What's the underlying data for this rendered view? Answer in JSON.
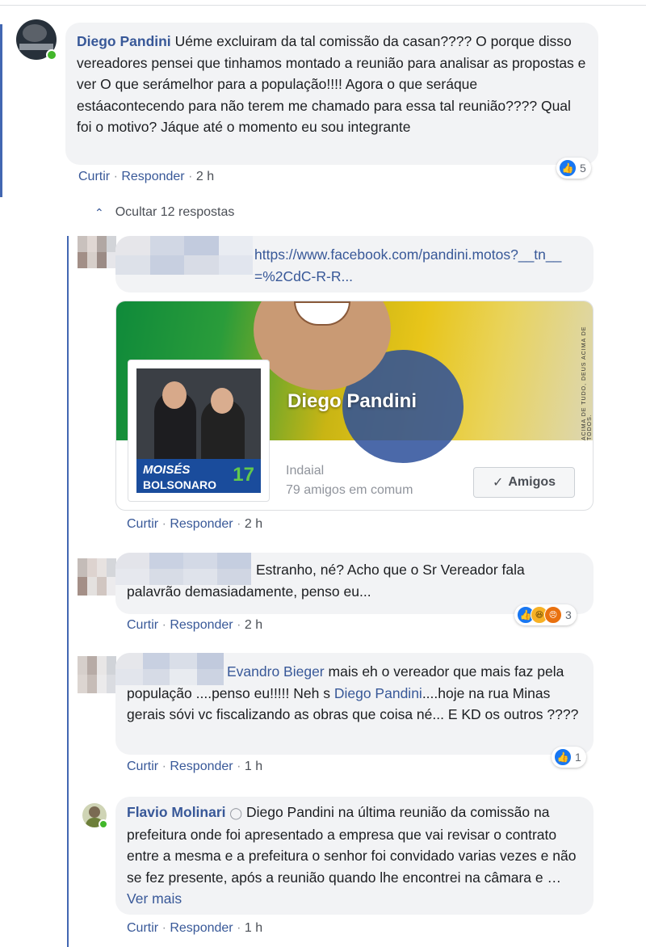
{
  "main_comment": {
    "author": "Diego Pandini",
    "text": "Uéme excluiram da tal comissão da casan???? O porque disso vereadores pensei que tinhamos montado a reunião para analisar as propostas e ver O que serámelhor para a população!!!! Agora o que seráque estáacontecendo para não terem me chamado para essa tal reunião???? Qual foi o motivo? Jáque até o momento eu sou integrante",
    "actions": {
      "like": "Curtir",
      "reply": "Responder",
      "time": "2 h"
    },
    "reaction_count": "5"
  },
  "replies_toggle": {
    "label": "Ocultar 12 respostas"
  },
  "reply1": {
    "link_text": "https://www.facebook.com/pandini.motos?__tn__=%2CdC-R-R...",
    "card": {
      "profile_name": "Diego Pandini",
      "cover_vertical_text": "ACIMA DE TUDO, DEUS ACIMA DE TODOS.",
      "picture_text_1": "MOISÉS",
      "picture_text_2": "BOLSONARO",
      "picture_number": "17",
      "location": "Indaial",
      "mutual_friends": "79 amigos em comum",
      "friends_button": "Amigos"
    },
    "actions": {
      "like": "Curtir",
      "reply": "Responder",
      "time": "2 h"
    }
  },
  "reply2": {
    "text": "Estranho, né? Acho que o Sr Vereador fala palavrão demasiadamente, penso eu...",
    "actions": {
      "like": "Curtir",
      "reply": "Responder",
      "time": "2 h"
    },
    "reaction_count": "3"
  },
  "reply3": {
    "mention1": "Evandro Bieger",
    "text1": " mais eh o vereador que mais faz pela população ....penso eu!!!!! Neh s ",
    "mention2": "Diego Pandini",
    "text2": "....hoje na rua Minas gerais sóvi vc fiscalizando as obras que coisa né... E KD os outros ????",
    "actions": {
      "like": "Curtir",
      "reply": "Responder",
      "time": "1 h"
    },
    "reaction_count": "1"
  },
  "reply4": {
    "author": "Flavio Molinari",
    "text": " Diego Pandini na última reunião da comissão na prefeitura onde foi apresentado a empresa que vai revisar o contrato entre a mesma e a prefeitura o senhor foi convidado varias vezes e não se fez presente, após a reunião quando lhe encontrei na câmara e … ",
    "see_more": "Ver mais",
    "actions": {
      "like": "Curtir",
      "reply": "Responder",
      "time": "1 h"
    }
  },
  "colors": {
    "accent": "#4267b2",
    "link": "#385898",
    "bubble": "#f2f3f5",
    "online": "#42b72a"
  }
}
